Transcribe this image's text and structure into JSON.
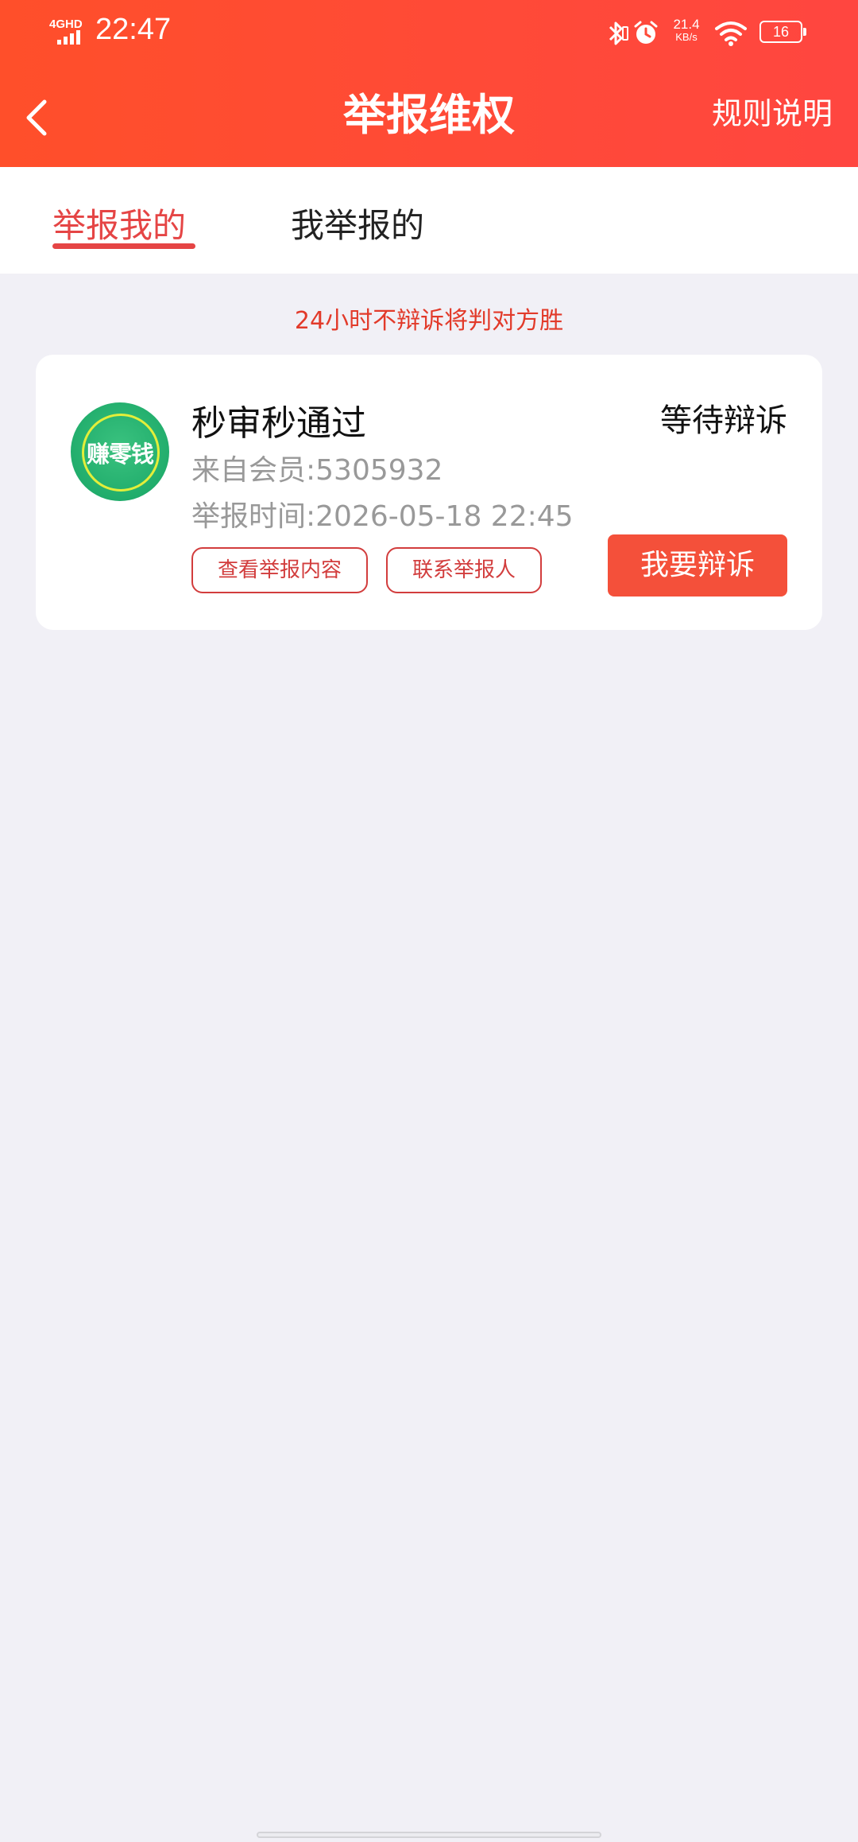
{
  "status_bar": {
    "network": "4GHD",
    "time": "22:47",
    "speed_value": "21.4",
    "speed_unit": "KB/s",
    "battery": "16"
  },
  "header": {
    "title": "举报维权",
    "rules_label": "规则说明",
    "back_icon": "chevron-left-icon"
  },
  "tabs": [
    {
      "label": "举报我的",
      "active": true
    },
    {
      "label": "我举报的",
      "active": false
    }
  ],
  "notice": "24小时不辩诉将判对方胜",
  "report": {
    "avatar_text": "赚零钱",
    "title": "秒审秒通过",
    "status": "等待辩诉",
    "member": "来自会员:5305932",
    "time": "举报时间:2026-05-18 22:45",
    "view_button": "查看举报内容",
    "contact_button": "联系举报人",
    "defend_button": "我要辩诉"
  },
  "colors": {
    "header_gradient_start": "#ff4f2a",
    "header_gradient_end": "#ff4640",
    "accent_red": "#e54545",
    "defend_button_bg": "#f4503a",
    "page_bg": "#f1f0f6"
  }
}
